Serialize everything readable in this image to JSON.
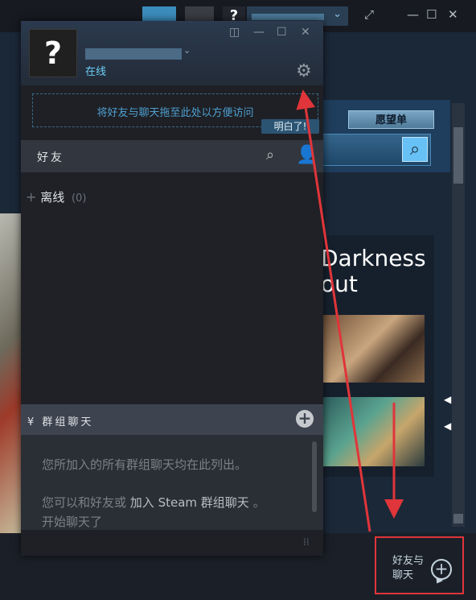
{
  "titlebar": {
    "avatar_glyph": "?",
    "account_dropdown_glyph": "⌄",
    "window_controls": [
      "⤢",
      "—",
      "☐",
      "✕"
    ]
  },
  "store": {
    "wishlist_label": "愿望单",
    "promo_title": "Darkness\nout",
    "search_icon": "search-icon"
  },
  "friends_window": {
    "avatar_glyph": "?",
    "status": "在线",
    "controls": [
      "◫",
      "—",
      "☐",
      "✕"
    ],
    "settings_icon": "gear-icon",
    "drop_hint": "将好友与聊天拖至此处以方便访问",
    "got_it": "明白了!",
    "search_label": "好友",
    "offline_section": {
      "expand_glyph": "+",
      "label": "离线",
      "count": "(0)"
    },
    "group_chats": {
      "title": "群组聊天",
      "description": "您所加入的所有群组聊天均在此列出。",
      "hint_prefix": "您可以和好友或",
      "hint_link": "加入 Steam 群组聊天",
      "hint_suffix": "。开始聊天了"
    }
  },
  "friends_button": {
    "label": "好友与聊天",
    "icon": "add-chat-icon"
  },
  "colors": {
    "annotation": "#e0353a",
    "accent": "#6dcff6",
    "window_bg": "#1e2025"
  }
}
